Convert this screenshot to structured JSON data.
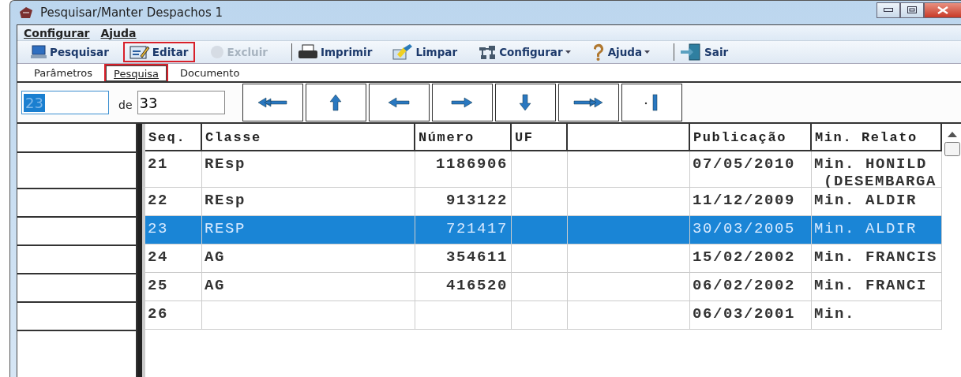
{
  "window": {
    "title": "Pesquisar/Manter Despachos 1"
  },
  "menu": [
    "Configurar",
    "Ajuda"
  ],
  "toolbar": [
    {
      "kind": "search",
      "label": "Pesquisar",
      "disabled": false,
      "highlighted": false,
      "dropdown": false,
      "separator_before": false
    },
    {
      "kind": "edit",
      "label": "Editar",
      "disabled": false,
      "highlighted": true,
      "dropdown": false,
      "separator_before": false
    },
    {
      "kind": "delete",
      "label": "Excluir",
      "disabled": true,
      "highlighted": false,
      "dropdown": false,
      "separator_before": false
    },
    {
      "kind": "print",
      "label": "Imprimir",
      "disabled": false,
      "highlighted": false,
      "dropdown": false,
      "separator_before": true
    },
    {
      "kind": "clear",
      "label": "Limpar",
      "disabled": false,
      "highlighted": false,
      "dropdown": false,
      "separator_before": false
    },
    {
      "kind": "config",
      "label": "Configurar",
      "disabled": false,
      "highlighted": false,
      "dropdown": true,
      "separator_before": false
    },
    {
      "kind": "help",
      "label": "Ajuda",
      "disabled": false,
      "highlighted": false,
      "dropdown": true,
      "separator_before": false
    },
    {
      "kind": "exit",
      "label": "Sair",
      "disabled": false,
      "highlighted": false,
      "dropdown": false,
      "separator_before": true
    }
  ],
  "tabs": [
    {
      "label": "Parâmetros",
      "selected": false,
      "highlighted": false
    },
    {
      "label": "Pesquisa",
      "selected": true,
      "highlighted": true
    },
    {
      "label": "Documento",
      "selected": false,
      "highlighted": false
    }
  ],
  "navigator": {
    "current": "23",
    "current_selected": true,
    "of_label": "de",
    "total": "33",
    "buttons": [
      {
        "kind": "first"
      },
      {
        "kind": "up"
      },
      {
        "kind": "prev"
      },
      {
        "kind": "next"
      },
      {
        "kind": "down"
      },
      {
        "kind": "last"
      },
      {
        "kind": "end"
      }
    ]
  },
  "table": {
    "columns": [
      "Seq.",
      "Classe",
      "Número",
      "UF",
      "",
      "Publicação",
      "Min. Relato"
    ],
    "rows": [
      {
        "seq": "21",
        "classe": "REsp",
        "numero": "1186906",
        "publicacao": "07/05/2010",
        "relator": [
          "Min. HONILD",
          "(DESEMBARGA"
        ],
        "selected": false
      },
      {
        "seq": "22",
        "classe": "REsp",
        "numero": "913122",
        "publicacao": "11/12/2009",
        "relator": [
          "Min. ALDIR"
        ],
        "selected": false
      },
      {
        "seq": "23",
        "classe": "RESP",
        "numero": "721417",
        "publicacao": "30/03/2005",
        "relator": [
          "Min. ALDIR"
        ],
        "selected": true
      },
      {
        "seq": "24",
        "classe": "AG",
        "numero": "354611",
        "publicacao": "15/02/2002",
        "relator": [
          "Min. FRANCIS"
        ],
        "selected": false
      },
      {
        "seq": "25",
        "classe": "AG",
        "numero": "416520",
        "publicacao": "06/02/2002",
        "relator": [
          "Min. FRANCI"
        ],
        "selected": false
      },
      {
        "seq": "26",
        "classe": "",
        "numero": "",
        "publicacao": "06/03/2001",
        "relator": [
          "Min."
        ],
        "selected": false
      }
    ]
  }
}
